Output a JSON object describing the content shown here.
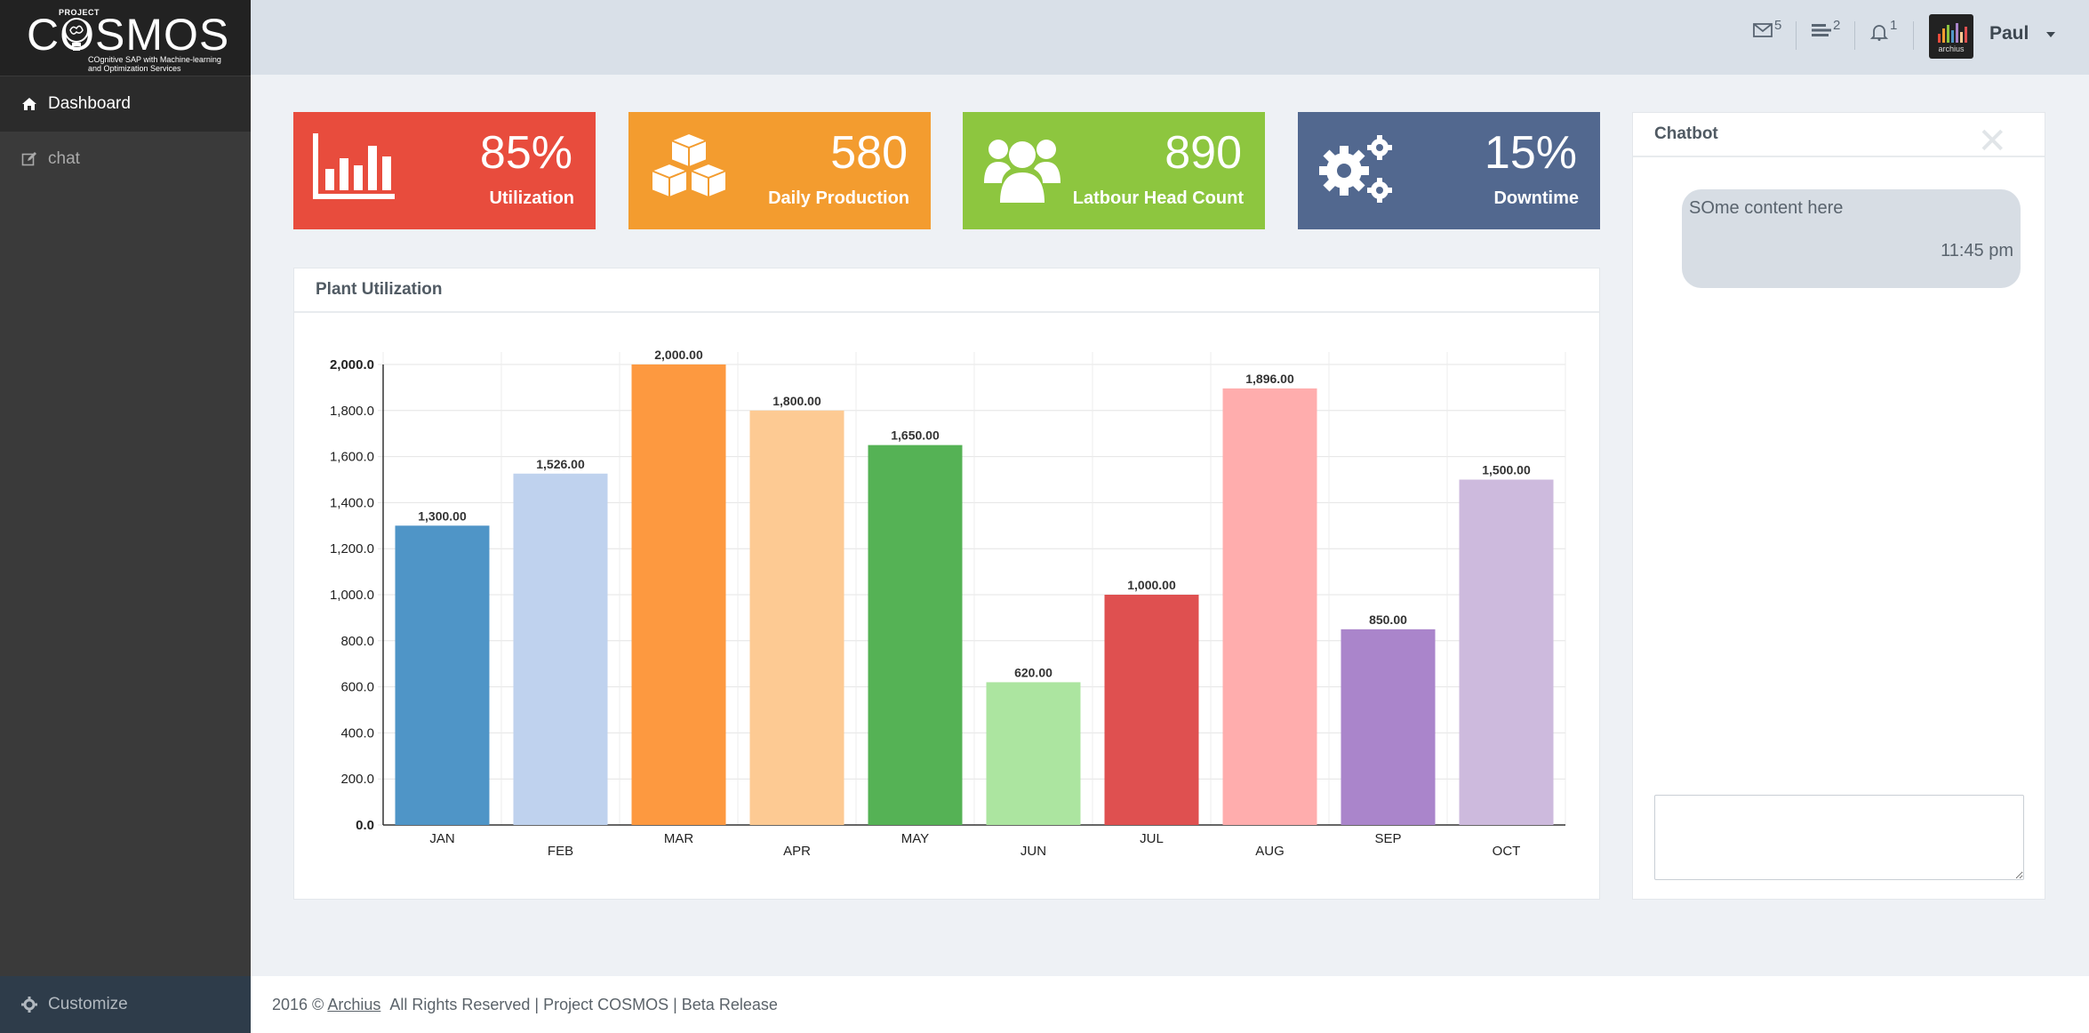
{
  "brand": {
    "project_label": "PROJECT",
    "name": "COSMOS",
    "tagline_line1": "COgnitive SAP with Machine-learning",
    "tagline_line2": "and Optimization Services"
  },
  "sidebar": {
    "items": [
      {
        "label": "Dashboard",
        "icon": "home-icon",
        "active": true
      },
      {
        "label": "chat",
        "icon": "edit-icon",
        "active": false
      }
    ],
    "customize_label": "Customize"
  },
  "topbar": {
    "mail_count": "5",
    "tasks_count": "2",
    "notifications_count": "1",
    "avatar_text": "archius",
    "user_name": "Paul"
  },
  "stats": [
    {
      "value": "85%",
      "label": "Utilization",
      "color": "#e84c3d",
      "icon": "bar-chart-icon"
    },
    {
      "value": "580",
      "label": "Daily Production",
      "color": "#f39c2f",
      "icon": "cubes-icon"
    },
    {
      "value": "890",
      "label": "Latbour Head Count",
      "color": "#8dc63f",
      "icon": "users-icon"
    },
    {
      "value": "15%",
      "label": "Downtime",
      "color": "#52688f",
      "icon": "gears-icon"
    }
  ],
  "chart_panel": {
    "title": "Plant Utilization"
  },
  "chart_data": {
    "type": "bar",
    "categories": [
      "JAN",
      "FEB",
      "MAR",
      "APR",
      "MAY",
      "JUN",
      "JUL",
      "AUG",
      "SEP",
      "OCT"
    ],
    "values": [
      1300,
      1526,
      2000,
      1800,
      1650,
      620,
      1000,
      1896,
      850,
      1500
    ],
    "data_labels": [
      "1,300.00",
      "1,526.00",
      "2,000.00",
      "1,800.00",
      "1,650.00",
      "620.00",
      "1,000.00",
      "1,896.00",
      "850.00",
      "1,500.00"
    ],
    "bar_colors": [
      "#4f95c7",
      "#bfd2ee",
      "#fd9940",
      "#fdca93",
      "#55b255",
      "#ace5a0",
      "#df5050",
      "#ffadad",
      "#aa85cb",
      "#cdbadd"
    ],
    "y_ticks": [
      "0.0",
      "200.0",
      "400.0",
      "600.0",
      "800.0",
      "1,000.0",
      "1,200.0",
      "1,400.0",
      "1,600.0",
      "1,800.0",
      "2,000.0"
    ],
    "ylim": [
      0,
      2000
    ],
    "grid": true,
    "title": "Plant Utilization",
    "xlabel": "",
    "ylabel": ""
  },
  "chatbot": {
    "title": "Chatbot",
    "close_symbol": "✕",
    "messages": [
      {
        "text": "SOme content here",
        "time": "11:45 pm"
      }
    ],
    "input_placeholder": ""
  },
  "footer": {
    "prefix": "2016 ©",
    "link": "Archius",
    "suffix": "All Rights Reserved | Project COSMOS | Beta Release"
  }
}
